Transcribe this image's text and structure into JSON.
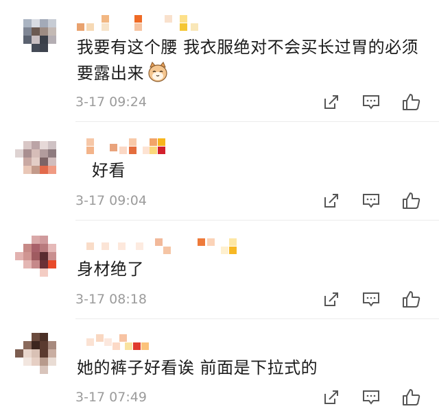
{
  "comments": [
    {
      "text": "我要有这个腰 我衣服绝对不会买长过胃的必须要露出来",
      "emoji": "cat-emoji",
      "time": "3-17 09:24"
    },
    {
      "text": "好看",
      "time": "3-17 09:04"
    },
    {
      "text": "身材绝了",
      "time": "3-17 08:18"
    },
    {
      "text": "她的裤子好看诶 前面是下拉式的",
      "time": "3-17 07:49"
    }
  ],
  "icons": {
    "share": "share-icon",
    "comment": "comment-icon",
    "like": "like-icon"
  },
  "colors": {
    "text": "#1b1b1b",
    "meta": "#9b9b9b",
    "icon": "#555555",
    "divider": "#ebebeb"
  }
}
